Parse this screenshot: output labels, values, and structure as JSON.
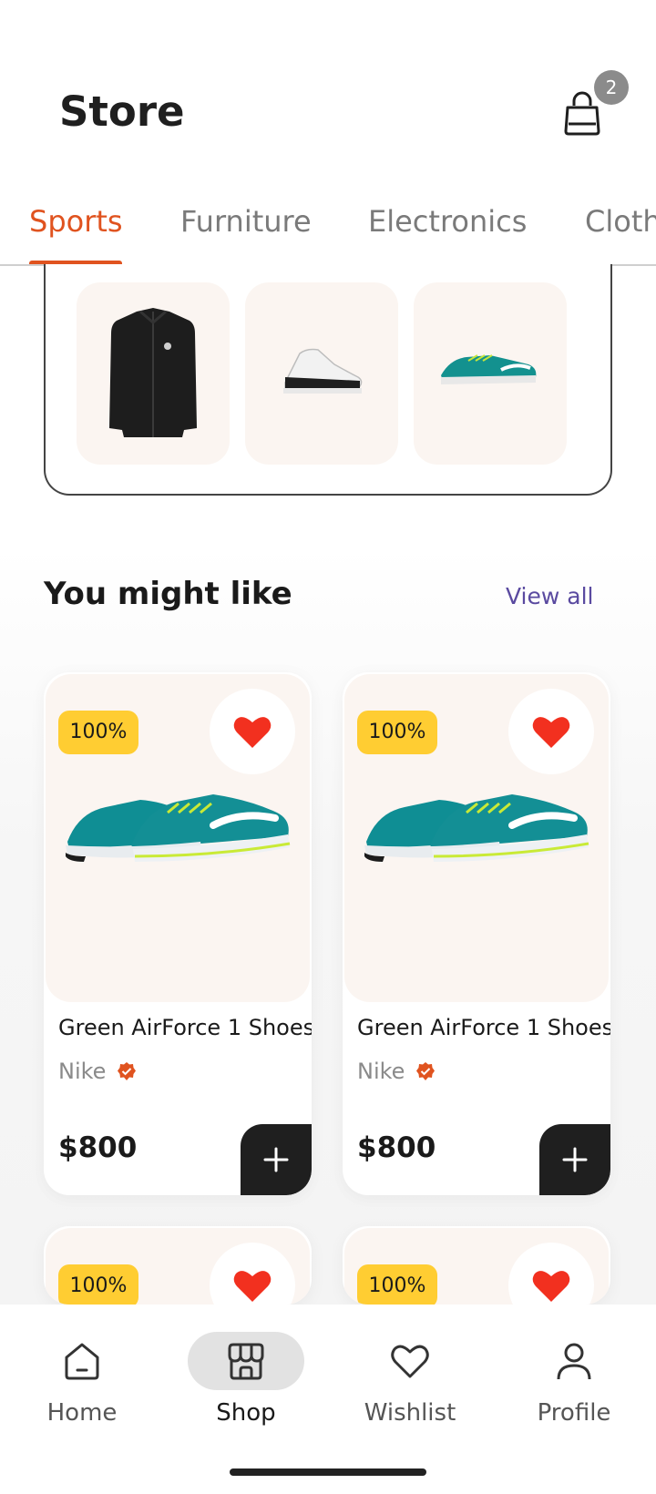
{
  "header": {
    "title": "Store",
    "cart_count": "2"
  },
  "tabs": [
    {
      "label": "Sports",
      "active": true
    },
    {
      "label": "Furniture",
      "active": false
    },
    {
      "label": "Electronics",
      "active": false
    },
    {
      "label": "Clothes",
      "active": false
    }
  ],
  "brand_showcase": {
    "images": [
      "jacket",
      "white-sneaker",
      "teal-running-shoe"
    ]
  },
  "section": {
    "title": "You might like",
    "view_all_label": "View all"
  },
  "products": [
    {
      "discount": "100%",
      "name": "Green AirForce 1 Shoes",
      "brand": "Nike",
      "price": "$800",
      "favorite": true
    },
    {
      "discount": "100%",
      "name": "Green AirForce 1 Shoes",
      "brand": "Nike",
      "price": "$800",
      "favorite": true
    },
    {
      "discount": "100%",
      "favorite": true
    },
    {
      "discount": "100%",
      "favorite": true
    }
  ],
  "bottom_nav": {
    "items": [
      {
        "label": "Home",
        "icon": "home-icon",
        "active": false
      },
      {
        "label": "Shop",
        "icon": "shop-icon",
        "active": true
      },
      {
        "label": "Wishlist",
        "icon": "heart-icon",
        "active": false
      },
      {
        "label": "Profile",
        "icon": "user-icon",
        "active": false
      }
    ]
  },
  "colors": {
    "accent": "#e0531f",
    "badge": "#ffcd32",
    "heart": "#f2301f",
    "thumb_bg": "#fbf5f1",
    "link": "#5a4aa0"
  }
}
